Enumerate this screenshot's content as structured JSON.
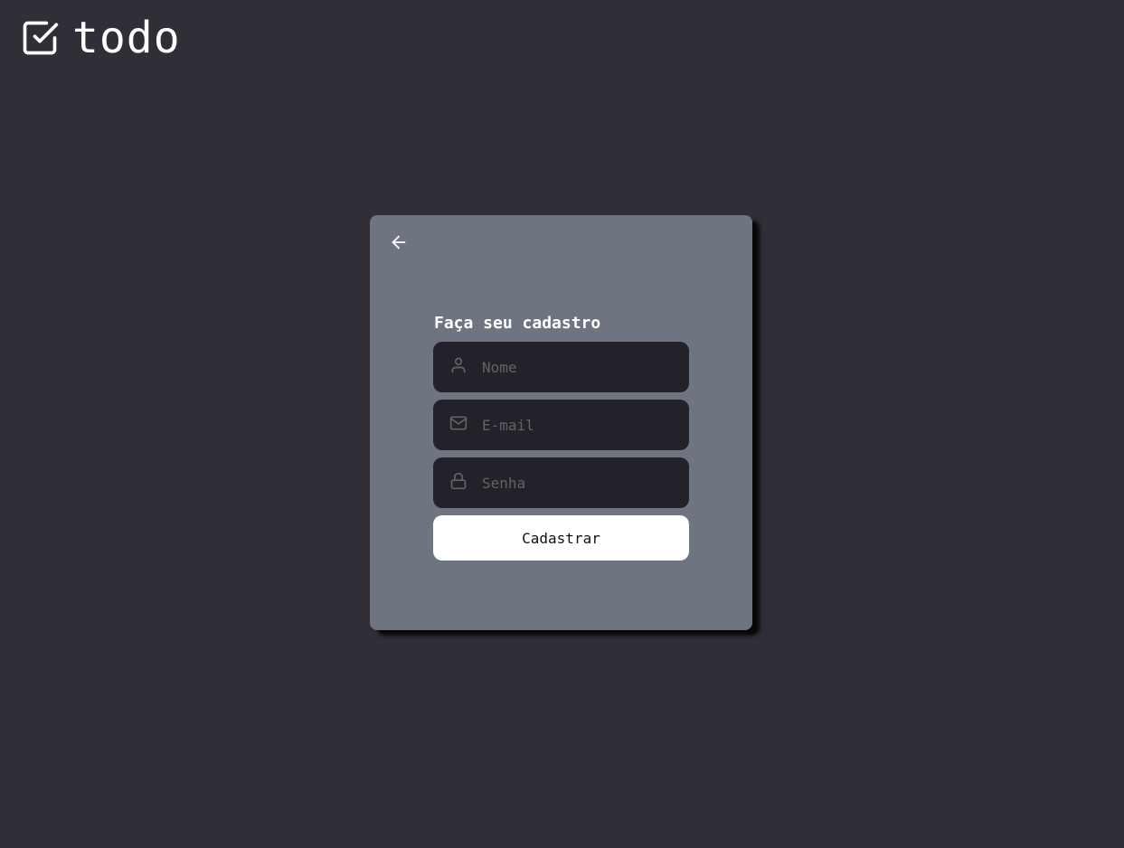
{
  "brand": {
    "name": "todo",
    "logo_icon": "check-square-icon"
  },
  "card": {
    "back_icon": "arrow-left-icon",
    "title": "Faça seu cadastro",
    "fields": {
      "name": {
        "placeholder": "Nome",
        "value": "",
        "icon": "user-icon"
      },
      "email": {
        "placeholder": "E-mail",
        "value": "",
        "icon": "mail-icon"
      },
      "password": {
        "placeholder": "Senha",
        "value": "",
        "icon": "lock-icon"
      }
    },
    "submit_label": "Cadastrar"
  },
  "colors": {
    "background": "#312e38",
    "card": "#6e7580",
    "input": "#232129",
    "placeholder": "#666360",
    "button": "#ffffff"
  }
}
